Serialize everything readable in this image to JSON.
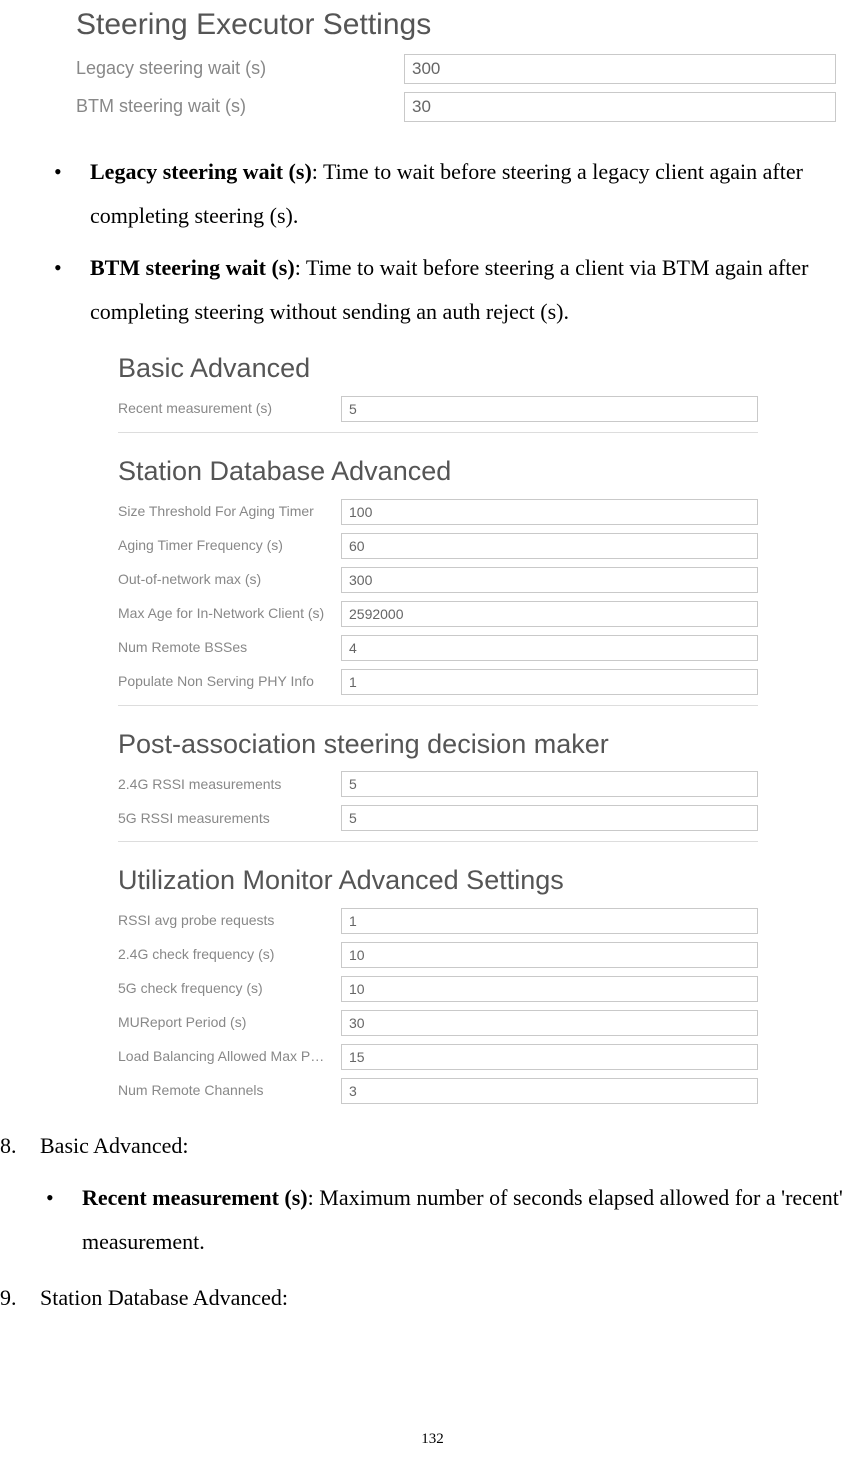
{
  "page_number": "132",
  "panel1": {
    "heading": "Steering Executor Settings",
    "fields": [
      {
        "label": "Legacy steering wait (s)",
        "value": "300",
        "name": "legacy-steering-wait-input"
      },
      {
        "label": "BTM steering wait (s)",
        "value": "30",
        "name": "btm-steering-wait-input"
      }
    ]
  },
  "bullets1": [
    {
      "term": "Legacy steering wait (s)",
      "desc": ": Time to wait before steering a legacy client again after completing steering (s)."
    },
    {
      "term": "BTM steering wait (s)",
      "desc": ": Time to wait before steering a client via BTM again after completing steering without sending an auth reject (s)."
    }
  ],
  "panel2": {
    "heading": "Basic Advanced",
    "fields": [
      {
        "label": "Recent measurement (s)",
        "value": "5",
        "name": "recent-measurement-input"
      }
    ]
  },
  "panel3": {
    "heading": "Station Database Advanced",
    "fields": [
      {
        "label": "Size Threshold For Aging Timer",
        "value": "100",
        "name": "size-threshold-aging-timer-input"
      },
      {
        "label": "Aging Timer Frequency (s)",
        "value": "60",
        "name": "aging-timer-frequency-input"
      },
      {
        "label": "Out-of-network max (s)",
        "value": "300",
        "name": "out-of-network-max-input"
      },
      {
        "label": "Max Age for In-Network Client (s)",
        "value": "2592000",
        "name": "max-age-in-network-client-input"
      },
      {
        "label": "Num Remote BSSes",
        "value": "4",
        "name": "num-remote-bsses-input"
      },
      {
        "label": "Populate Non Serving PHY Info",
        "value": "1",
        "name": "populate-non-serving-phy-input"
      }
    ]
  },
  "panel4": {
    "heading": "Post-association steering decision maker",
    "fields": [
      {
        "label": "2.4G RSSI measurements",
        "value": "5",
        "name": "24g-rssi-measurements-input"
      },
      {
        "label": "5G RSSI measurements",
        "value": "5",
        "name": "5g-rssi-measurements-input"
      }
    ]
  },
  "panel5": {
    "heading": "Utilization Monitor Advanced Settings",
    "fields": [
      {
        "label": "RSSI avg probe requests",
        "value": "1",
        "name": "rssi-avg-probe-requests-input"
      },
      {
        "label": "2.4G check frequency (s)",
        "value": "10",
        "name": "24g-check-frequency-input"
      },
      {
        "label": "5G check frequency (s)",
        "value": "10",
        "name": "5g-check-frequency-input"
      },
      {
        "label": "MUReport Period (s)",
        "value": "30",
        "name": "mureport-period-input"
      },
      {
        "label": "Load Balancing Allowed Max P…",
        "value": "15",
        "name": "load-balancing-allowed-max-input"
      },
      {
        "label": "Num Remote Channels",
        "value": "3",
        "name": "num-remote-channels-input"
      }
    ]
  },
  "item8": {
    "mark": "8.",
    "text": "Basic Advanced:",
    "bullets": [
      {
        "term": "Recent measurement (s)",
        "desc": ": Maximum number of seconds elapsed allowed for a 'recent' measurement."
      }
    ]
  },
  "item9": {
    "mark": "9.",
    "text": "Station Database Advanced:"
  }
}
